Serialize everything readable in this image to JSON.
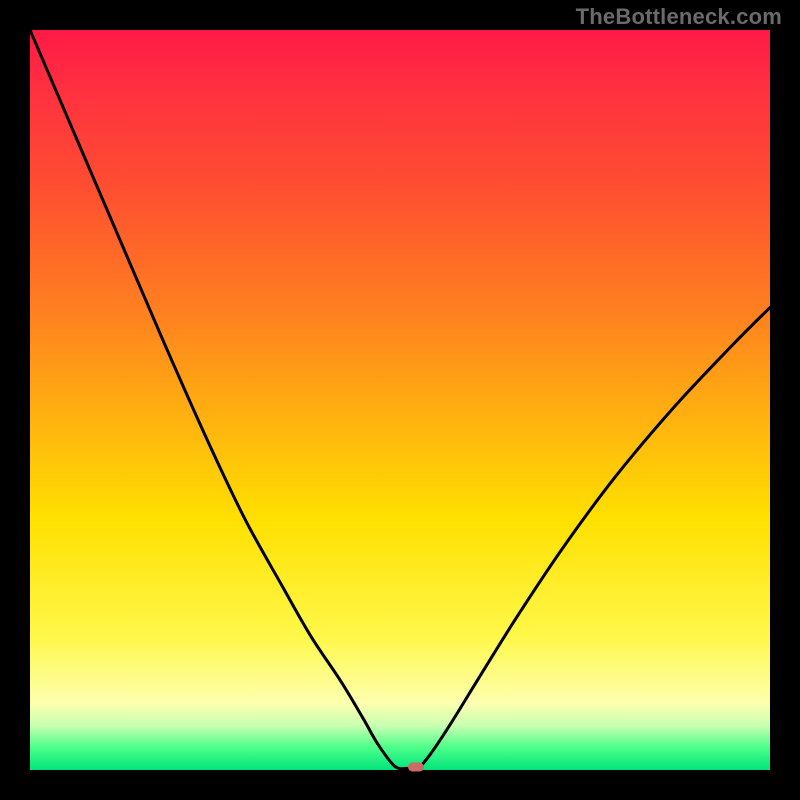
{
  "watermark": "TheBottleneck.com",
  "chart_data": {
    "type": "line",
    "title": "",
    "xlabel": "",
    "ylabel": "",
    "xlim": [
      0,
      1
    ],
    "ylim": [
      0,
      1
    ],
    "background": "rainbow-gradient-vertical",
    "series": [
      {
        "name": "bottleneck-curve",
        "x": [
          0.0,
          0.06,
          0.12,
          0.18,
          0.24,
          0.29,
          0.34,
          0.38,
          0.42,
          0.45,
          0.47,
          0.493,
          0.51,
          0.522,
          0.54,
          0.57,
          0.61,
          0.66,
          0.72,
          0.79,
          0.87,
          0.95,
          1.0
        ],
        "y": [
          1.0,
          0.86,
          0.72,
          0.58,
          0.445,
          0.34,
          0.25,
          0.18,
          0.12,
          0.07,
          0.035,
          0.005,
          0.002,
          0.0,
          0.02,
          0.065,
          0.13,
          0.21,
          0.3,
          0.395,
          0.49,
          0.575,
          0.625
        ]
      }
    ],
    "marker": {
      "name": "current-point",
      "x": 0.522,
      "y": 0.0,
      "color": "#cc6b63"
    }
  },
  "colors": {
    "frame": "#000000",
    "curve": "#000000",
    "marker": "#cc6b63"
  }
}
